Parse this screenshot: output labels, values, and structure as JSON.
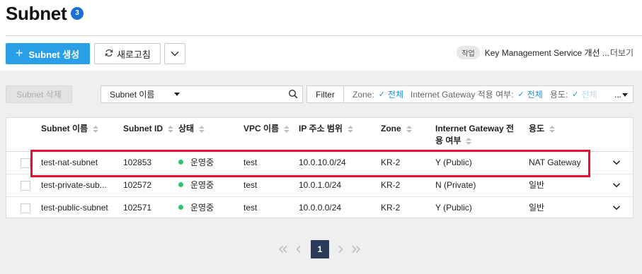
{
  "header": {
    "title": "Subnet",
    "count_badge": "3",
    "create_button": "Subnet 생성",
    "refresh_button": "새로고침",
    "notice": {
      "tag": "작업",
      "text": "Key Management Service 개선 ...",
      "more": "더보기"
    }
  },
  "toolbar": {
    "delete_button": "Subnet 삭제",
    "search_field_select": "Subnet 이름",
    "search_placeholder": "",
    "filter_button": "Filter",
    "filters": [
      {
        "label": "Zone:",
        "value": "전체"
      },
      {
        "label": "Internet Gateway 적용 여부:",
        "value": "전체"
      },
      {
        "label": "용도:",
        "value": "전체"
      }
    ],
    "filter_overflow": "..."
  },
  "table": {
    "columns": [
      {
        "key": "name",
        "label": "Subnet 이름"
      },
      {
        "key": "id",
        "label": "Subnet ID"
      },
      {
        "key": "status",
        "label": "상태"
      },
      {
        "key": "vpc",
        "label": "VPC 이름"
      },
      {
        "key": "cidr",
        "label": "IP 주소 범위"
      },
      {
        "key": "zone",
        "label": "Zone"
      },
      {
        "key": "igw_line1",
        "label": "Internet Gateway 전"
      },
      {
        "key": "igw_line2",
        "label": "용 여부"
      },
      {
        "key": "usage",
        "label": "용도"
      }
    ],
    "rows": [
      {
        "name": "test-nat-subnet",
        "id": "102853",
        "status": "운영중",
        "vpc": "test",
        "cidr": "10.0.10.0/24",
        "zone": "KR-2",
        "igw": "Y (Public)",
        "usage": "NAT Gateway"
      },
      {
        "name": "test-private-sub...",
        "id": "102572",
        "status": "운영중",
        "vpc": "test",
        "cidr": "10.0.1.0/24",
        "zone": "KR-2",
        "igw": "N (Private)",
        "usage": "일반"
      },
      {
        "name": "test-public-subnet",
        "id": "102571",
        "status": "운영중",
        "vpc": "test",
        "cidr": "10.0.0.0/24",
        "zone": "KR-2",
        "igw": "Y (Public)",
        "usage": "일반"
      }
    ],
    "status_color": "#2cc46a",
    "highlight_color": "#e8112d"
  },
  "pagination": {
    "current_page": "1",
    "first_icon": "double-chevron-left-icon",
    "prev_icon": "chevron-left-icon",
    "next_icon": "chevron-right-icon",
    "last_icon": "double-chevron-right-icon"
  },
  "colors": {
    "accent": "#2a9fe8",
    "badge": "#1d6fd8",
    "pager_active": "#2c3a5a"
  }
}
